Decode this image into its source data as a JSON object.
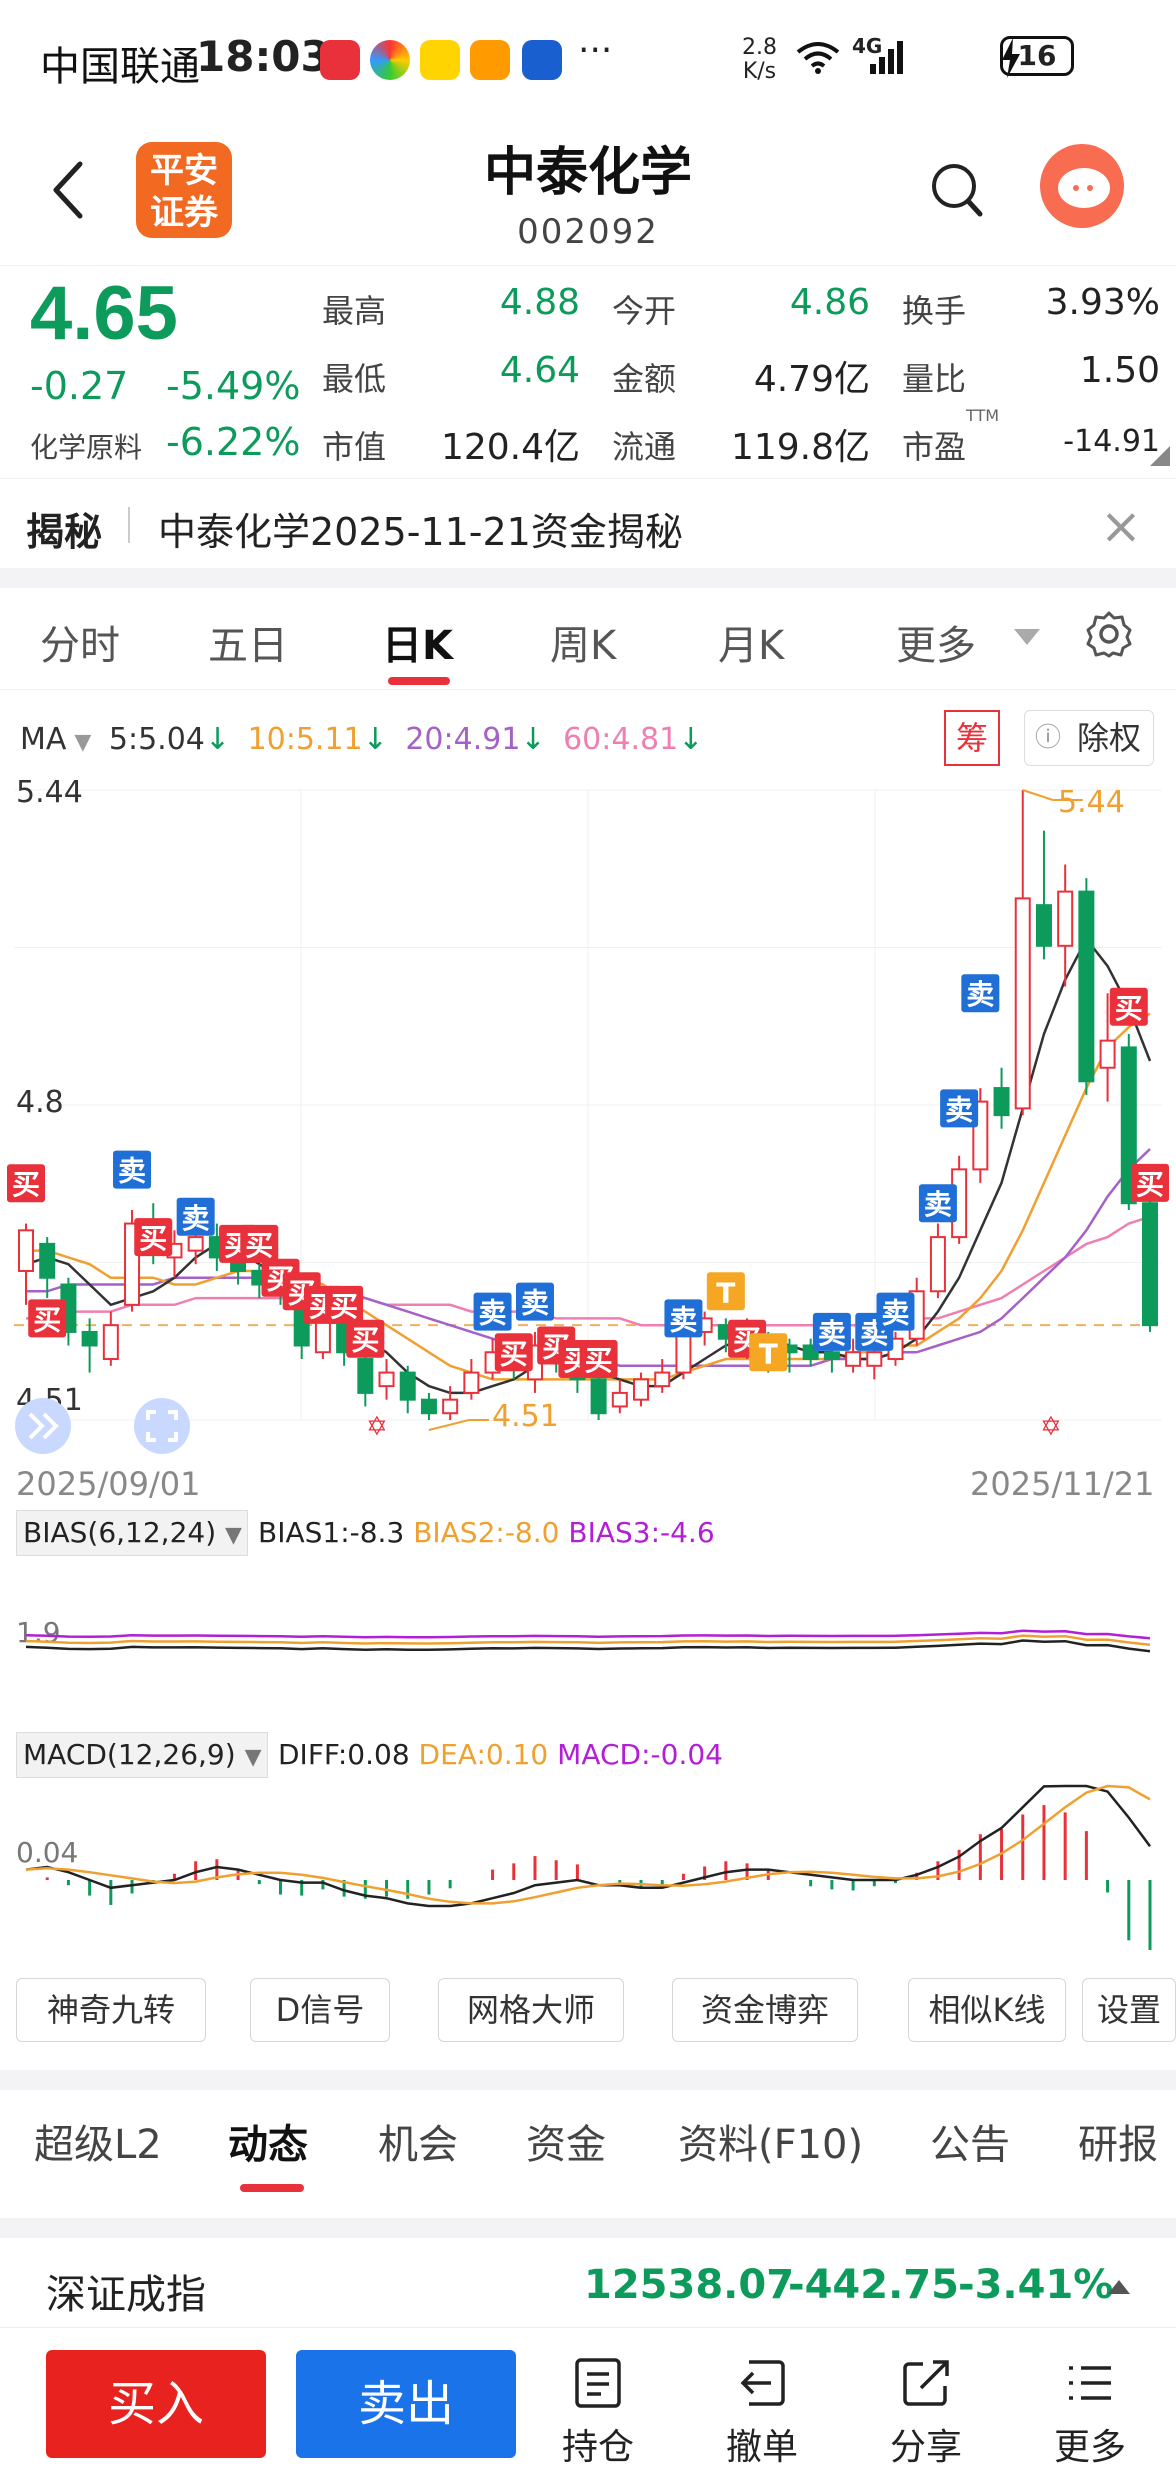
{
  "status_bar": {
    "carrier": "中国联通",
    "time": "18:03",
    "more": "···",
    "speed_value": "2.8",
    "speed_unit": "K/s",
    "network": "4G",
    "battery": "16"
  },
  "header": {
    "back_icon": "chevron-left-icon",
    "broker_logo": "平安\n证券",
    "broker_logo_line1": "平安",
    "broker_logo_line2": "证券",
    "stock_name": "中泰化学",
    "stock_code": "002092",
    "search_icon": "search-icon"
  },
  "quote": {
    "price": "4.65",
    "change": "-0.27",
    "change_pct": "-5.49%",
    "sector_name": "化学原料",
    "sector_pct": "-6.22%",
    "fields": {
      "high_label": "最高",
      "high": "4.88",
      "low_label": "最低",
      "low": "4.64",
      "cap_label": "市值",
      "cap": "120.4亿",
      "open_label": "今开",
      "open": "4.86",
      "amount_label": "金额",
      "amount": "4.79亿",
      "float_label": "流通",
      "float": "119.8亿",
      "turnover_label": "换手",
      "turnover": "3.93%",
      "vol_ratio_label": "量比",
      "vol_ratio": "1.50",
      "pe_label": "市盈",
      "pe_sup": "TTM",
      "pe": "-14.91"
    }
  },
  "reveal": {
    "title": "揭秘",
    "text": "中泰化学2025-11-21资金揭秘",
    "close": "×"
  },
  "chart_tabs": [
    "分时",
    "五日",
    "日K",
    "周K",
    "月K",
    "更多"
  ],
  "chart_tab_active": "日K",
  "ma": {
    "label": "MA",
    "ma5": "5:5.04",
    "ma10": "10:5.11",
    "ma20": "20:4.91",
    "ma60": "60:4.81",
    "chou": "筹",
    "chuquan": "除权",
    "colors": {
      "ma5": "#333333",
      "ma10": "#f0a030",
      "ma20": "#a561c8",
      "ma60": "#ef7fb2"
    }
  },
  "kchart": {
    "max_label": "5.44",
    "min_label": "4.51",
    "side_label": "4.8",
    "high_marker": "5.44",
    "low_marker": "4.51",
    "date_start": "2025/09/01",
    "date_end": "2025/11/21",
    "buy_tag": "买",
    "sell_tag": "卖",
    "t_tag": "T",
    "candles": [
      {
        "o": 4.73,
        "c": 4.79,
        "h": 4.8,
        "l": 4.68
      },
      {
        "o": 4.77,
        "c": 4.72,
        "h": 4.78,
        "l": 4.69
      },
      {
        "o": 4.71,
        "c": 4.64,
        "h": 4.72,
        "l": 4.62
      },
      {
        "o": 4.64,
        "c": 4.62,
        "h": 4.66,
        "l": 4.58
      },
      {
        "o": 4.6,
        "c": 4.65,
        "h": 4.67,
        "l": 4.59
      },
      {
        "o": 4.68,
        "c": 4.8,
        "h": 4.82,
        "l": 4.67
      },
      {
        "o": 4.8,
        "c": 4.76,
        "h": 4.83,
        "l": 4.74
      },
      {
        "o": 4.75,
        "c": 4.77,
        "h": 4.79,
        "l": 4.72
      },
      {
        "o": 4.76,
        "c": 4.78,
        "h": 4.8,
        "l": 4.74
      },
      {
        "o": 4.78,
        "c": 4.75,
        "h": 4.8,
        "l": 4.73
      },
      {
        "o": 4.75,
        "c": 4.73,
        "h": 4.76,
        "l": 4.71
      },
      {
        "o": 4.73,
        "c": 4.71,
        "h": 4.74,
        "l": 4.69
      },
      {
        "o": 4.71,
        "c": 4.7,
        "h": 4.72,
        "l": 4.68
      },
      {
        "o": 4.7,
        "c": 4.62,
        "h": 4.71,
        "l": 4.6
      },
      {
        "o": 4.61,
        "c": 4.68,
        "h": 4.7,
        "l": 4.6
      },
      {
        "o": 4.66,
        "c": 4.61,
        "h": 4.67,
        "l": 4.59
      },
      {
        "o": 4.6,
        "c": 4.55,
        "h": 4.61,
        "l": 4.53
      },
      {
        "o": 4.56,
        "c": 4.58,
        "h": 4.6,
        "l": 4.54
      },
      {
        "o": 4.58,
        "c": 4.54,
        "h": 4.59,
        "l": 4.52
      },
      {
        "o": 4.54,
        "c": 4.52,
        "h": 4.55,
        "l": 4.51
      },
      {
        "o": 4.52,
        "c": 4.54,
        "h": 4.56,
        "l": 4.51
      },
      {
        "o": 4.55,
        "c": 4.58,
        "h": 4.6,
        "l": 4.54
      },
      {
        "o": 4.58,
        "c": 4.61,
        "h": 4.63,
        "l": 4.57
      },
      {
        "o": 4.61,
        "c": 4.59,
        "h": 4.63,
        "l": 4.57
      },
      {
        "o": 4.57,
        "c": 4.62,
        "h": 4.64,
        "l": 4.55
      },
      {
        "o": 4.62,
        "c": 4.6,
        "h": 4.64,
        "l": 4.58
      },
      {
        "o": 4.6,
        "c": 4.57,
        "h": 4.61,
        "l": 4.55
      },
      {
        "o": 4.57,
        "c": 4.52,
        "h": 4.58,
        "l": 4.51
      },
      {
        "o": 4.53,
        "c": 4.55,
        "h": 4.57,
        "l": 4.52
      },
      {
        "o": 4.54,
        "c": 4.57,
        "h": 4.58,
        "l": 4.53
      },
      {
        "o": 4.56,
        "c": 4.58,
        "h": 4.6,
        "l": 4.55
      },
      {
        "o": 4.58,
        "c": 4.64,
        "h": 4.66,
        "l": 4.57
      },
      {
        "o": 4.64,
        "c": 4.66,
        "h": 4.67,
        "l": 4.62
      },
      {
        "o": 4.65,
        "c": 4.63,
        "h": 4.66,
        "l": 4.61
      },
      {
        "o": 4.62,
        "c": 4.64,
        "h": 4.66,
        "l": 4.6
      },
      {
        "o": 4.62,
        "c": 4.59,
        "h": 4.64,
        "l": 4.58
      },
      {
        "o": 4.62,
        "c": 4.61,
        "h": 4.63,
        "l": 4.58
      },
      {
        "o": 4.62,
        "c": 4.6,
        "h": 4.63,
        "l": 4.59
      },
      {
        "o": 4.61,
        "c": 4.6,
        "h": 4.62,
        "l": 4.58
      },
      {
        "o": 4.59,
        "c": 4.61,
        "h": 4.63,
        "l": 4.58
      },
      {
        "o": 4.59,
        "c": 4.61,
        "h": 4.62,
        "l": 4.57
      },
      {
        "o": 4.6,
        "c": 4.63,
        "h": 4.64,
        "l": 4.59
      },
      {
        "o": 4.63,
        "c": 4.7,
        "h": 4.72,
        "l": 4.62
      },
      {
        "o": 4.7,
        "c": 4.78,
        "h": 4.8,
        "l": 4.69
      },
      {
        "o": 4.78,
        "c": 4.88,
        "h": 4.9,
        "l": 4.77
      },
      {
        "o": 4.88,
        "c": 4.98,
        "h": 5.0,
        "l": 4.86
      },
      {
        "o": 5.0,
        "c": 4.96,
        "h": 5.03,
        "l": 4.94
      },
      {
        "o": 4.97,
        "c": 5.28,
        "h": 5.44,
        "l": 4.96
      },
      {
        "o": 5.27,
        "c": 5.21,
        "h": 5.38,
        "l": 5.19
      },
      {
        "o": 5.21,
        "c": 5.29,
        "h": 5.33,
        "l": 5.15
      },
      {
        "o": 5.29,
        "c": 5.01,
        "h": 5.31,
        "l": 4.99
      },
      {
        "o": 5.03,
        "c": 5.07,
        "h": 5.14,
        "l": 4.98
      },
      {
        "o": 5.06,
        "c": 4.83,
        "h": 5.08,
        "l": 4.82
      },
      {
        "o": 4.83,
        "c": 4.65,
        "h": 4.86,
        "l": 4.64
      }
    ],
    "ma5": [
      4.74,
      4.75,
      4.74,
      4.71,
      4.68,
      4.69,
      4.7,
      4.72,
      4.75,
      4.77,
      4.76,
      4.74,
      4.72,
      4.7,
      4.69,
      4.66,
      4.63,
      4.61,
      4.58,
      4.56,
      4.55,
      4.55,
      4.56,
      4.57,
      4.59,
      4.6,
      4.6,
      4.58,
      4.57,
      4.56,
      4.56,
      4.58,
      4.6,
      4.62,
      4.63,
      4.63,
      4.62,
      4.61,
      4.61,
      4.6,
      4.6,
      4.61,
      4.63,
      4.67,
      4.72,
      4.79,
      4.86,
      4.97,
      5.08,
      5.16,
      5.22,
      5.18,
      5.12,
      5.04
    ],
    "ma10": [
      4.76,
      4.76,
      4.75,
      4.74,
      4.72,
      4.72,
      4.72,
      4.71,
      4.71,
      4.72,
      4.73,
      4.73,
      4.73,
      4.72,
      4.71,
      4.69,
      4.67,
      4.65,
      4.63,
      4.61,
      4.59,
      4.58,
      4.57,
      4.57,
      4.57,
      4.57,
      4.57,
      4.57,
      4.57,
      4.57,
      4.57,
      4.58,
      4.59,
      4.6,
      4.6,
      4.6,
      4.6,
      4.6,
      4.6,
      4.61,
      4.61,
      4.62,
      4.62,
      4.64,
      4.66,
      4.69,
      4.73,
      4.79,
      4.86,
      4.93,
      5.0,
      5.06,
      5.09,
      5.11
    ],
    "ma20": [
      4.7,
      4.7,
      4.71,
      4.71,
      4.71,
      4.71,
      4.71,
      4.72,
      4.72,
      4.72,
      4.72,
      4.72,
      4.72,
      4.71,
      4.7,
      4.7,
      4.69,
      4.68,
      4.67,
      4.66,
      4.65,
      4.64,
      4.63,
      4.62,
      4.61,
      4.61,
      4.6,
      4.6,
      4.59,
      4.59,
      4.59,
      4.59,
      4.59,
      4.59,
      4.59,
      4.59,
      4.59,
      4.59,
      4.6,
      4.6,
      4.6,
      4.61,
      4.61,
      4.62,
      4.63,
      4.64,
      4.66,
      4.69,
      4.72,
      4.75,
      4.79,
      4.84,
      4.88,
      4.91
    ],
    "ma60": [
      4.66,
      4.66,
      4.67,
      4.67,
      4.67,
      4.68,
      4.68,
      4.68,
      4.69,
      4.69,
      4.69,
      4.69,
      4.69,
      4.69,
      4.69,
      4.69,
      4.69,
      4.68,
      4.68,
      4.68,
      4.68,
      4.67,
      4.67,
      4.67,
      4.67,
      4.66,
      4.66,
      4.66,
      4.66,
      4.65,
      4.65,
      4.65,
      4.65,
      4.65,
      4.65,
      4.65,
      4.65,
      4.65,
      4.65,
      4.65,
      4.65,
      4.65,
      4.66,
      4.66,
      4.67,
      4.68,
      4.69,
      4.71,
      4.73,
      4.75,
      4.77,
      4.78,
      4.8,
      4.81
    ]
  },
  "bias": {
    "label": "BIAS(6,12,24)",
    "bias1": "BIAS1:-8.3",
    "bias2": "BIAS2:-8.0",
    "bias3": "BIAS3:-4.6",
    "axis_label": "1.9"
  },
  "macd": {
    "label": "MACD(12,26,9)",
    "diff": "DIFF:0.08",
    "dea": "DEA:0.10",
    "macd": "MACD:-0.04",
    "axis_label": "0.04"
  },
  "indicator_buttons": [
    "神奇九转",
    "D信号",
    "网格大师",
    "资金博弈",
    "相似K线",
    "设置"
  ],
  "bottom_tabs": [
    "超级L2",
    "动态",
    "机会",
    "资金",
    "资料(F10)",
    "公告",
    "研报"
  ],
  "bottom_tab_active": "动态",
  "index": {
    "name": "深证成指",
    "value": "12538.07",
    "change": "-442.75",
    "pct": "-3.41%"
  },
  "toolbar": {
    "buy": "买入",
    "sell": "卖出",
    "holdings": "持仓",
    "cancel": "撤单",
    "share": "分享",
    "more": "更多"
  }
}
